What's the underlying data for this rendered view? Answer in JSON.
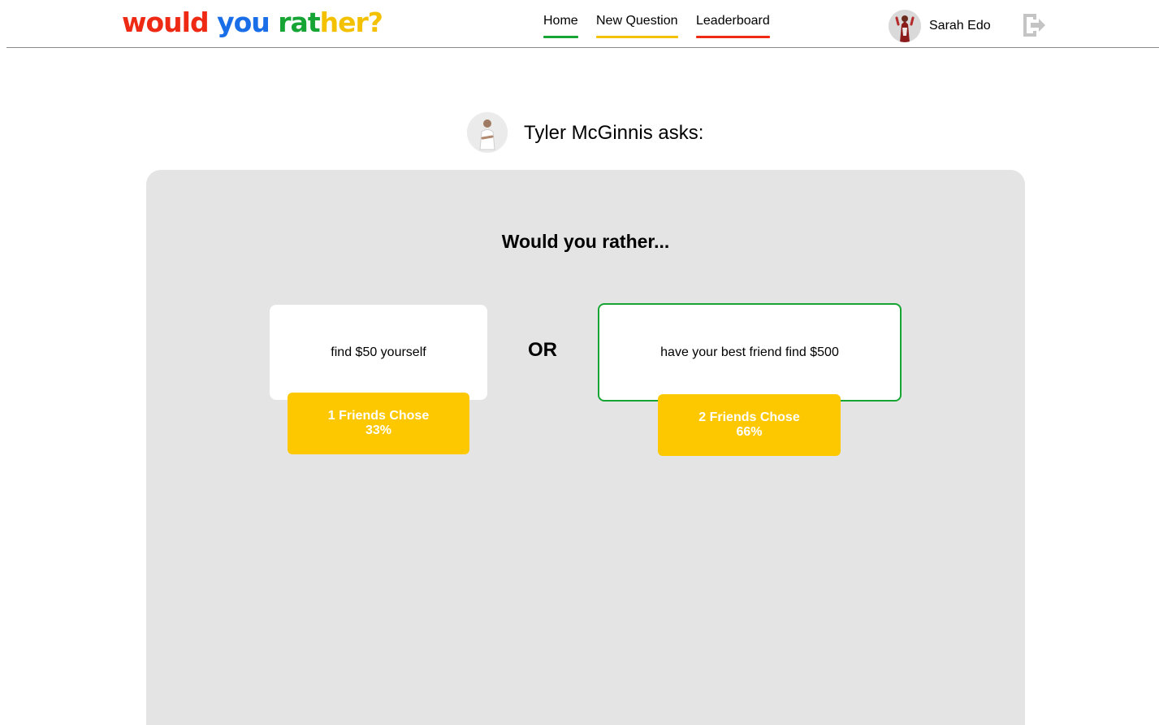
{
  "header": {
    "logo_parts": [
      "would",
      "you",
      "rat",
      "her?"
    ],
    "nav": {
      "home": "Home",
      "new_question": "New Question",
      "leaderboard": "Leaderboard"
    },
    "user": {
      "name": "Sarah Edo"
    },
    "icons": {
      "logout": "logout-icon",
      "avatar": "avatar"
    }
  },
  "question": {
    "author_label": "Tyler McGinnis asks:",
    "title": "Would you rather...",
    "or_label": "OR",
    "option_one": {
      "text": "find $50 yourself",
      "votes_line": "1 Friends Chose",
      "percent": "33%"
    },
    "option_two": {
      "text": "have your best friend find $500",
      "votes_line": "2 Friends Chose",
      "percent": "66%"
    }
  },
  "colors": {
    "logo_red": "#ee2a15",
    "logo_blue": "#1a6ee8",
    "logo_green": "#16a534",
    "logo_yellow": "#f3c100",
    "vote_badge": "#fdc800",
    "card_bg": "#e4e4e4",
    "selected_border": "#16a534"
  }
}
